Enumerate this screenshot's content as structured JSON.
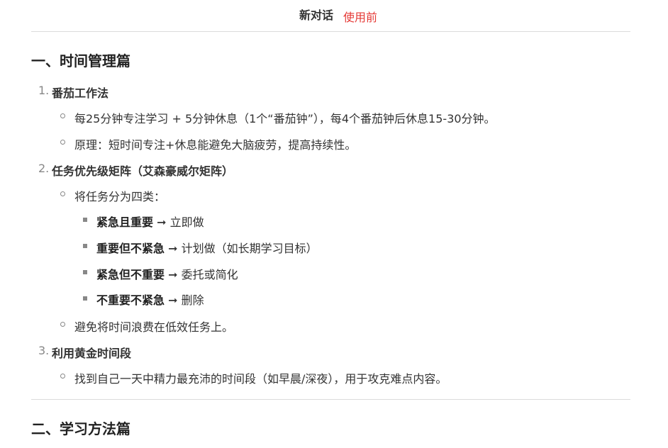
{
  "header": {
    "title": "新对话",
    "tag": "使用前"
  },
  "sections": [
    {
      "heading": "一、时间管理篇",
      "items": [
        {
          "number": "1.",
          "title": "番茄工作法",
          "bullets": [
            "每25分钟专注学习 + 5分钟休息（1个“番茄钟”），每4个番茄钟后休息15-30分钟。",
            "原理：短时间专注+休息能避免大脑疲劳，提高持续性。"
          ]
        },
        {
          "number": "2.",
          "title": "任务优先级矩阵（艾森豪威尔矩阵）",
          "bullets_intro": "将任务分为四类：",
          "sub_bullets": [
            {
              "bold": "紧急且重要",
              "rest": " ➞ 立即做"
            },
            {
              "bold": "重要但不紧急",
              "rest": " ➞ 计划做（如长期学习目标）"
            },
            {
              "bold": "紧急但不重要",
              "rest": " ➞ 委托或简化"
            },
            {
              "bold": "不重要不紧急",
              "rest": " ➞ 删除"
            }
          ],
          "bullet_after": "避免将时间浪费在低效任务上。"
        },
        {
          "number": "3.",
          "title": "利用黄金时间段",
          "bullets": [
            "找到自己一天中精力最充沛的时间段（如早晨/深夜），用于攻克难点内容。"
          ]
        }
      ]
    },
    {
      "heading": "二、学习方法篇"
    }
  ]
}
